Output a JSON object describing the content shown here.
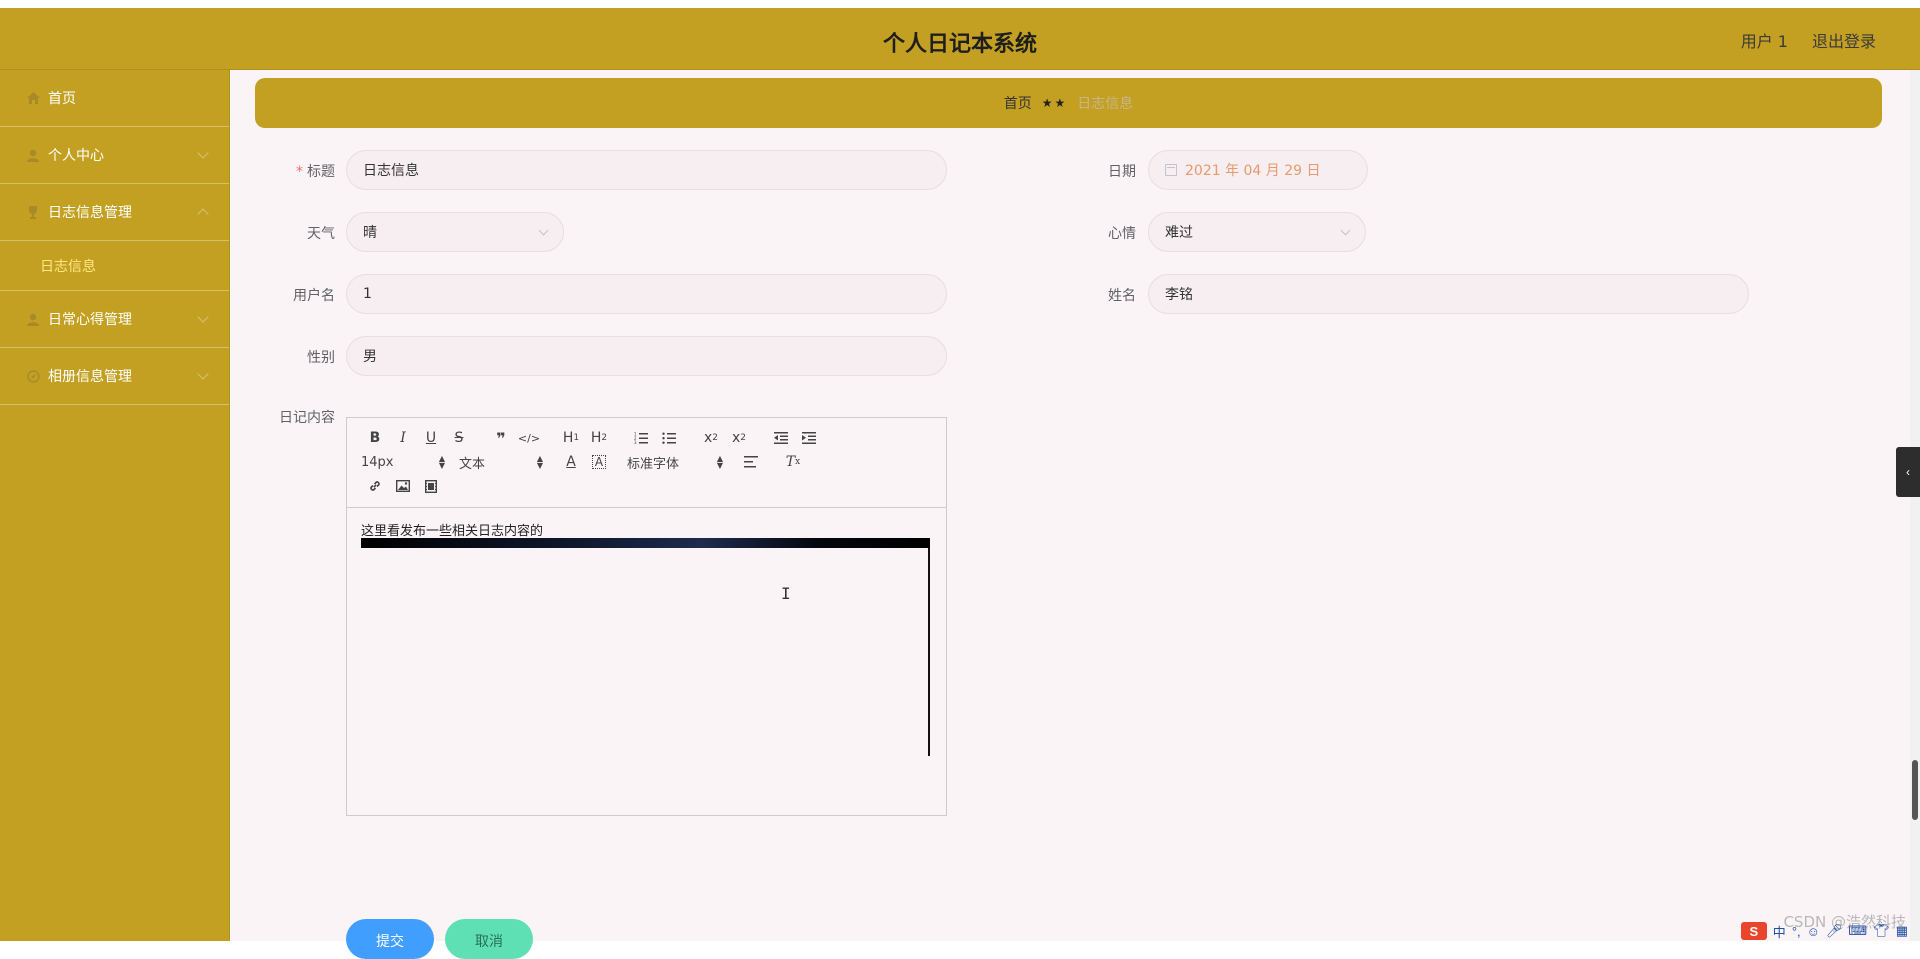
{
  "header": {
    "title": "个人日记本系统",
    "user": "用户 1",
    "logout": "退出登录"
  },
  "sidebar": {
    "items": [
      {
        "label": "首页",
        "icon": "home-icon"
      },
      {
        "label": "个人中心",
        "icon": "user-icon"
      },
      {
        "label": "日志信息管理",
        "icon": "trophy-icon"
      },
      {
        "label": "日常心得管理",
        "icon": "user-icon"
      },
      {
        "label": "相册信息管理",
        "icon": "compass-icon"
      }
    ],
    "subitem": "日志信息"
  },
  "breadcrumb": {
    "home": "首页",
    "separator": "★★",
    "current": "日志信息"
  },
  "form": {
    "title_label": "标题",
    "title_required": "*",
    "title_value": "日志信息",
    "date_label": "日期",
    "date_value": "2021 年 04 月 29 日",
    "weather_label": "天气",
    "weather_value": "晴",
    "mood_label": "心情",
    "mood_value": "难过",
    "username_label": "用户名",
    "username_value": "1",
    "name_label": "姓名",
    "name_value": "李铭",
    "gender_label": "性别",
    "gender_value": "男",
    "content_label": "日记内容"
  },
  "editor": {
    "font_size": "14px",
    "header_picker": "文本",
    "font_family": "标准字体",
    "content_text": "这里看发布一些相关日志内容的"
  },
  "buttons": {
    "submit": "提交",
    "cancel": "取消"
  },
  "watermark": "CSDN @浩然科技",
  "ime": {
    "logo": "S",
    "lang": "中"
  },
  "colors": {
    "header_bg": "#c4a022",
    "main_bg": "#faf4f7",
    "submit_bg": "#409eff",
    "cancel_bg": "#5ee0b4",
    "date_text": "#e89a6c"
  }
}
